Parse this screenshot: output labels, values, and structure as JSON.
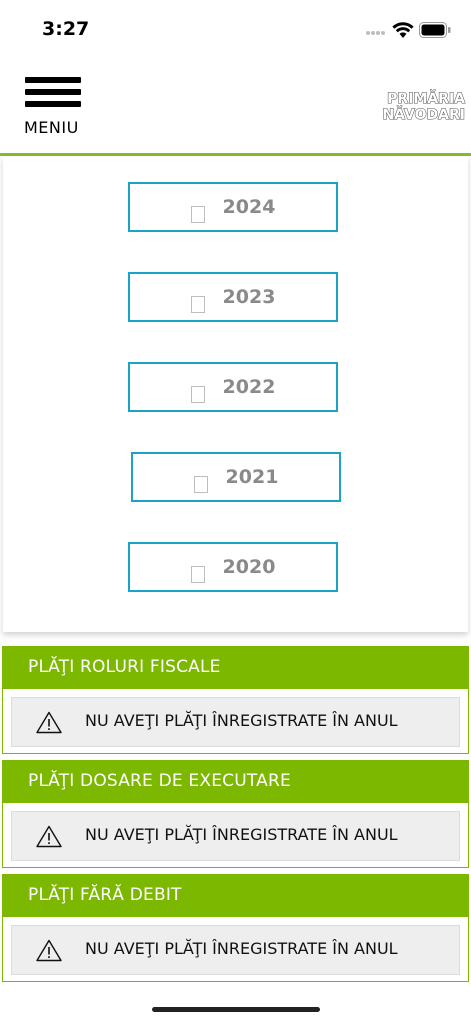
{
  "status_bar": {
    "time": "3:27",
    "icons": [
      "signal-dots-icon",
      "wifi-icon",
      "battery-icon"
    ]
  },
  "header": {
    "menu_label": "MENIU",
    "menu_icon": "hamburger-icon",
    "logo_line1": "PRIMĂRIA",
    "logo_line2": "NĂVODARI"
  },
  "colors": {
    "accent_green": "#7db800",
    "year_border_blue": "#1aa3c7",
    "year_text_gray": "#8a8a8a",
    "notice_bg": "#eeeeee"
  },
  "years": [
    {
      "label": "2024",
      "icon": "checkbox-icon"
    },
    {
      "label": "2023",
      "icon": "checkbox-icon"
    },
    {
      "label": "2022",
      "icon": "checkbox-icon"
    },
    {
      "label": "2021",
      "icon": "checkbox-icon"
    },
    {
      "label": "2020",
      "icon": "checkbox-icon"
    }
  ],
  "sections": [
    {
      "title": "PLĂŢI ROLURI FISCALE",
      "notice": "NU AVEŢI PLĂŢI ÎNREGISTRATE ÎN ANUL",
      "icon": "warning-icon"
    },
    {
      "title": "PLĂŢI DOSARE DE EXECUTARE",
      "notice": "NU AVEŢI PLĂŢI ÎNREGISTRATE ÎN ANUL",
      "icon": "warning-icon"
    },
    {
      "title": "PLĂŢI FĂRĂ DEBIT",
      "notice": "NU AVEŢI PLĂŢI ÎNREGISTRATE ÎN ANUL",
      "icon": "warning-icon"
    }
  ]
}
